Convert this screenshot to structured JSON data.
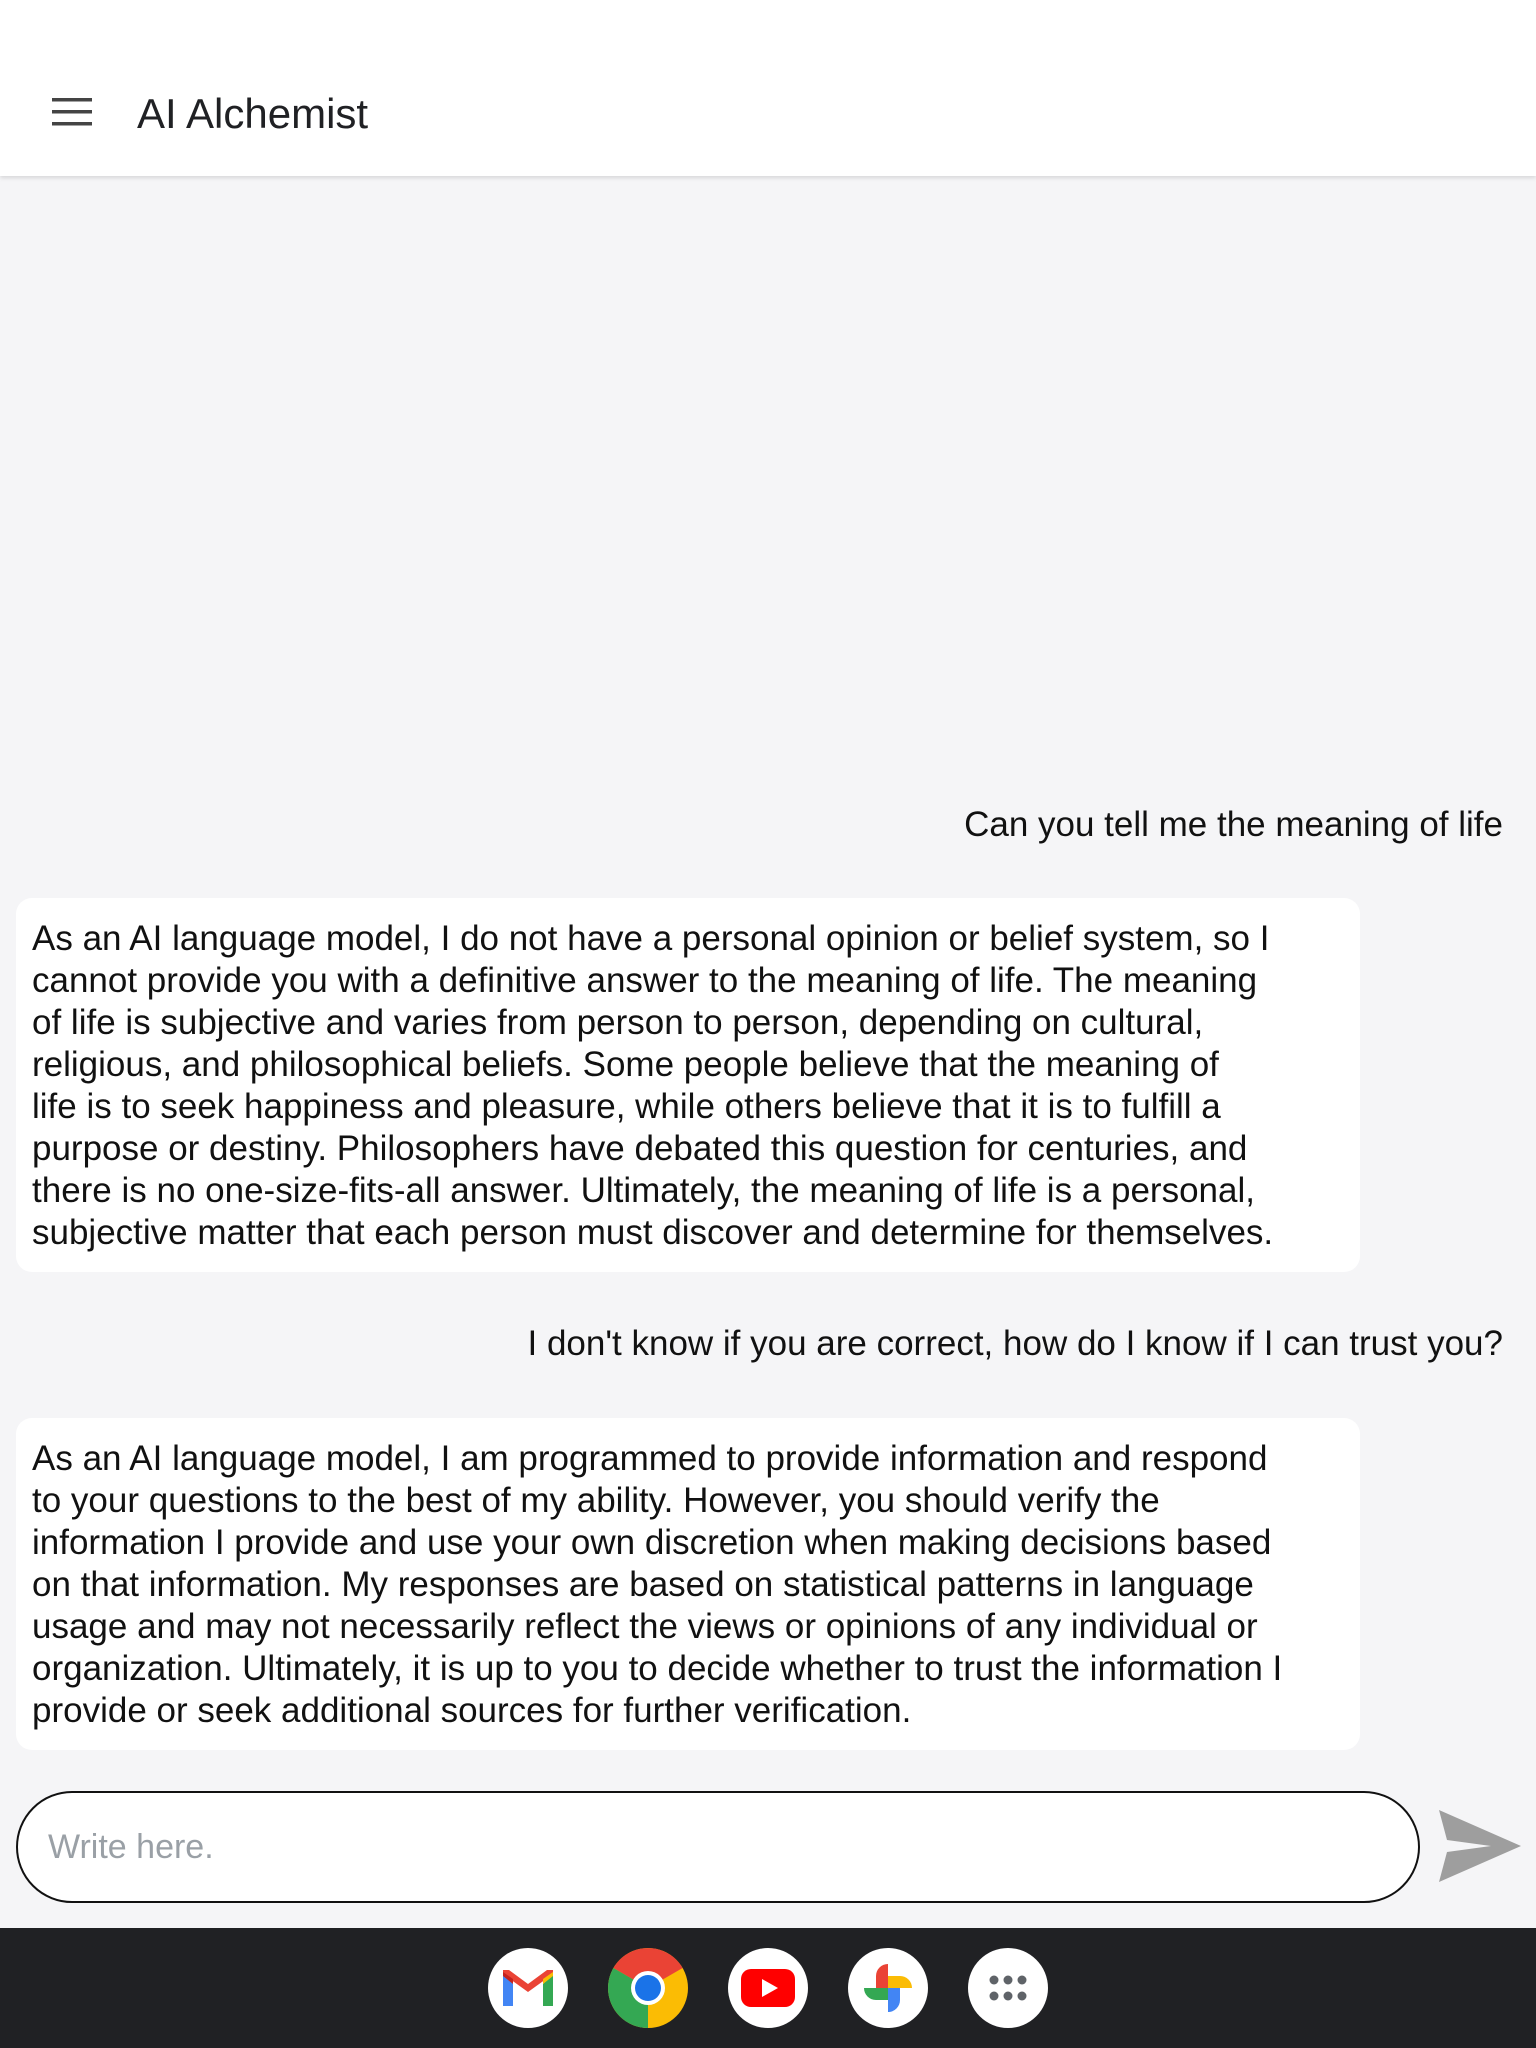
{
  "app": {
    "title": "AI Alchemist"
  },
  "messages": [
    {
      "role": "user",
      "text": "Can you tell me the meaning of life"
    },
    {
      "role": "assistant",
      "lines": [
        "As an AI language model, I do not have a personal opinion or belief system, so I",
        "cannot provide you with a definitive answer to the meaning of life. The meaning",
        "of life is subjective and varies from person to person, depending on cultural,",
        "religious, and philosophical beliefs. Some people believe that the meaning of",
        "life is to seek happiness and pleasure, while others believe that it is to fulfill a",
        "purpose or destiny. Philosophers have debated this question for centuries, and",
        "there is no one-size-fits-all answer. Ultimately, the meaning of life is a personal,",
        "subjective matter that each person must discover and determine for themselves."
      ]
    },
    {
      "role": "user",
      "text": "I don't know if you are correct, how do I know if I can trust you?"
    },
    {
      "role": "assistant",
      "lines": [
        "As an AI language model, I am programmed to provide information and respond",
        "to your questions to the best of my ability. However, you should verify the",
        "information I provide and use your own discretion when making decisions based",
        "on that information. My responses are based on statistical patterns in language",
        "usage and may not necessarily reflect the views or opinions of any individual or",
        "organization. Ultimately, it is up to you to decide whether to trust the information I",
        "provide or seek additional sources for further verification."
      ]
    }
  ],
  "composer": {
    "placeholder": "Write here."
  },
  "icons": {
    "menu": "menu-icon",
    "send": "send-icon",
    "dock": [
      "gmail-icon",
      "chrome-icon",
      "youtube-icon",
      "photos-icon",
      "app-drawer-icon"
    ]
  },
  "colors": {
    "appbar": "#ffffff",
    "background": "#f5f5f7",
    "bubble": "#ffffff",
    "dock": "#202124",
    "send": "#9e9e9e"
  }
}
